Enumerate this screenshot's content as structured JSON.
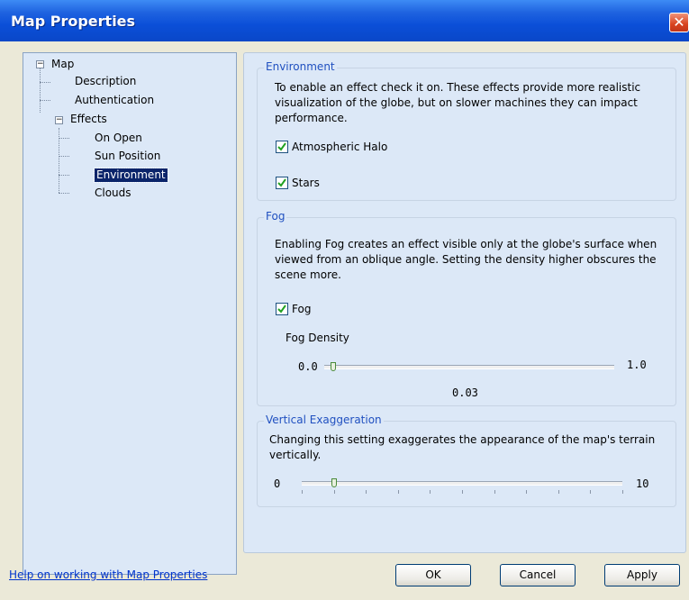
{
  "window": {
    "title": "Map Properties",
    "close_glyph": "✕"
  },
  "tree": {
    "items": [
      {
        "label": "Map",
        "expander": "−"
      },
      {
        "label": "Description"
      },
      {
        "label": "Authentication"
      },
      {
        "label": "Effects",
        "expander": "−"
      },
      {
        "label": "On Open"
      },
      {
        "label": "Sun Position"
      },
      {
        "label": "Environment",
        "selected": true
      },
      {
        "label": "Clouds"
      }
    ]
  },
  "environment": {
    "legend": "Environment",
    "description": "To enable an effect check it on.   These effects provide more realistic visualization of the globe, but on slower machines they can impact performance.",
    "atmospheric_halo": {
      "label": "Atmospheric Halo",
      "checked": true
    },
    "stars": {
      "label": "Stars",
      "checked": true
    }
  },
  "fog": {
    "legend": "Fog",
    "description": "Enabling Fog creates an effect visible only at the globe's surface when viewed from an oblique angle. Setting the density higher obscures the scene more.",
    "checkbox": {
      "label": "Fog",
      "checked": true
    },
    "density_label": "Fog Density",
    "min_label": "0.0",
    "max_label": "1.0",
    "value_label": "0.03",
    "value": 0.03
  },
  "vertical_exaggeration": {
    "legend": "Vertical Exaggeration",
    "description": "Changing this setting exaggerates the appearance of the map's terrain vertically.",
    "min_label": "0",
    "max_label": "10",
    "value": 1
  },
  "footer": {
    "help_link": "Help on working with Map Properties",
    "ok_label": "OK",
    "cancel_label": "Cancel",
    "apply_label": "Apply"
  }
}
